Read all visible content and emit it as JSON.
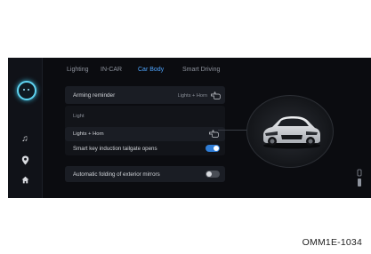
{
  "tabs": [
    {
      "label": "Lighting",
      "active": false
    },
    {
      "label": "IN-CAR",
      "active": false
    },
    {
      "label": "Car Body",
      "active": true
    },
    {
      "label": "Smart Driving",
      "active": false
    }
  ],
  "settings": {
    "arming_reminder": {
      "label": "Arming reminder",
      "value": "Lights + Horn"
    },
    "options": [
      {
        "label": "Light",
        "selected": false
      },
      {
        "label": "Lights + Horn",
        "selected": true
      }
    ],
    "tailgate": {
      "label": "Smart key induction tailgate opens",
      "enabled": true
    },
    "mirrors": {
      "label": "Automatic folding of exterior mirrors",
      "enabled": false
    }
  },
  "sidebar": {
    "icons": [
      "assistant-avatar-icon",
      "music-icon",
      "location-pin-icon",
      "home-icon"
    ]
  },
  "caption": "OMM1E-1034",
  "colors": {
    "accent": "#4fa6ff",
    "toggle_on": "#2f7dd6",
    "background": "#0b0c10"
  }
}
